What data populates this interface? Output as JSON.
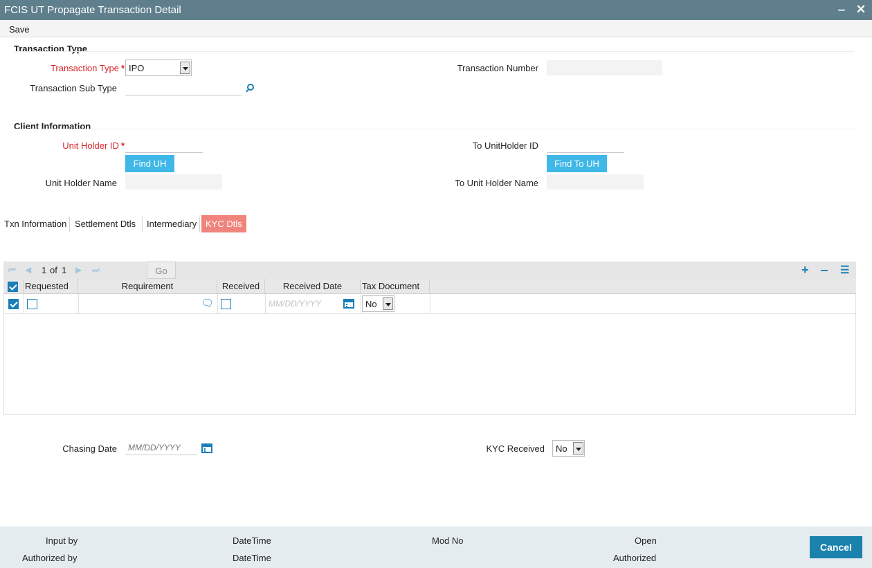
{
  "window": {
    "title": "FCIS UT Propagate Transaction Detail",
    "minimize": "‒",
    "close": "✕"
  },
  "menu": {
    "save_label": "Save"
  },
  "transaction_type_section": {
    "title": "Transaction Type",
    "transaction_type_label": "Transaction Type",
    "transaction_type_value": "IPO",
    "transaction_sub_type_label": "Transaction Sub Type",
    "transaction_sub_type_value": "",
    "transaction_number_label": "Transaction Number",
    "transaction_number_value": ""
  },
  "client_information": {
    "title": "Client Information",
    "unit_holder_id_label": "Unit Holder ID",
    "unit_holder_id_value": "",
    "find_uh_label": "Find UH",
    "unit_holder_name_label": "Unit Holder Name",
    "unit_holder_name_value": "",
    "to_unitholder_id_label": "To UnitHolder ID",
    "to_unitholder_id_value": "",
    "find_to_uh_label": "Find To UH",
    "to_unit_holder_name_label": "To Unit Holder Name",
    "to_unit_holder_name_value": ""
  },
  "tabs": [
    {
      "label": "Txn Information",
      "active": false
    },
    {
      "label": "Settlement Dtls",
      "active": false
    },
    {
      "label": "Intermediary",
      "active": false
    },
    {
      "label": "KYC Dtls",
      "active": true
    }
  ],
  "grid": {
    "page_current": "1",
    "page_of": "of",
    "page_total": "1",
    "go_label": "Go",
    "columns": [
      "Requested",
      "Requirement",
      "Received",
      "Received Date",
      "Tax Document"
    ],
    "rows": [
      {
        "selected": true,
        "requested": false,
        "requirement": "",
        "received": false,
        "received_date_placeholder": "MM/DD/YYYY",
        "tax_document": "No"
      }
    ],
    "icons": {
      "add": "+",
      "delete": "‒",
      "view": "☰"
    }
  },
  "chasing_date": {
    "label": "Chasing Date",
    "placeholder": "MM/DD/YYYY"
  },
  "kyc_received": {
    "label": "KYC Received",
    "value": "No"
  },
  "footer": {
    "input_by": "Input by",
    "authorized_by": "Authorized by",
    "datetime_1": "DateTime",
    "datetime_2": "DateTime",
    "mod_no": "Mod No",
    "open": "Open",
    "authorized": "Authorized",
    "cancel_label": "Cancel"
  },
  "colors": {
    "titlebar": "#5f7f8d",
    "accent_blue": "#3fb8e8",
    "active_tab": "#f0847c",
    "cancel": "#1a82ad",
    "required": "#d8232a"
  }
}
